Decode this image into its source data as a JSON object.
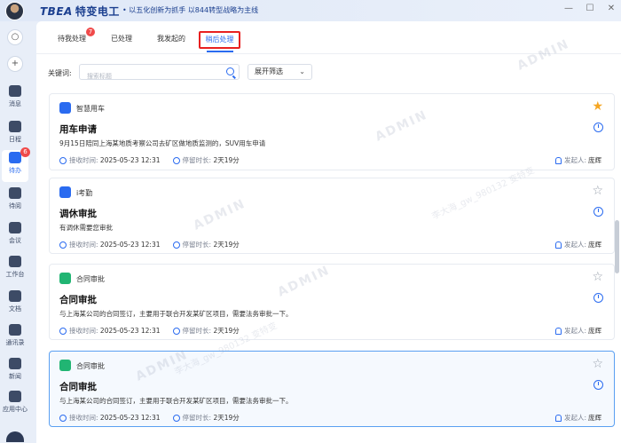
{
  "header": {
    "logo_latin": "TBEA",
    "logo_cn": "特变电工",
    "slogan": "• 以五化创新为抓手 以844转型战略为主线"
  },
  "window": {
    "minimize_icon": "minimize-icon",
    "maximize_icon": "maximize-icon",
    "close_icon": "close-icon"
  },
  "sidebar": {
    "items": [
      {
        "label": "消息",
        "icon": "message-icon"
      },
      {
        "label": "日程",
        "icon": "calendar-icon"
      },
      {
        "label": "待办",
        "icon": "todo-icon",
        "badge": "6",
        "active": true
      },
      {
        "label": "待阅",
        "icon": "toread-icon"
      },
      {
        "label": "会议",
        "icon": "meeting-icon"
      },
      {
        "label": "工作台",
        "icon": "workbench-icon"
      },
      {
        "label": "文档",
        "icon": "document-icon"
      },
      {
        "label": "通讯录",
        "icon": "contacts-icon"
      },
      {
        "label": "新闻",
        "icon": "news-icon"
      },
      {
        "label": "应用中心",
        "icon": "appcenter-icon"
      }
    ]
  },
  "tabs": [
    {
      "label": "待我处理",
      "badge": "7"
    },
    {
      "label": "已处理"
    },
    {
      "label": "我发起的"
    },
    {
      "label": "稍后处理",
      "active": true
    }
  ],
  "filters": {
    "keyword_label": "关键词:",
    "search_placeholder": "搜索标题",
    "filter_button": "展开筛选"
  },
  "cards": [
    {
      "app": "智慧用车",
      "app_color": "#2a6bf0",
      "title": "用车申请",
      "desc": "9月15日陪同上海某地质考察公司去矿区做地质监测的，SUV用车申请",
      "received_label": "接收时间:",
      "received": "2025-05-23  12:31",
      "stay_label": "停留时长:",
      "stay": "2天19分",
      "initiator_label": "发起人:",
      "initiator": "庞辉",
      "starred": true
    },
    {
      "app": "i考勤",
      "app_color": "#2a6bf0",
      "title": "调休审批",
      "desc": "有调休需要您审批",
      "received_label": "接收时间:",
      "received": "2025-05-23  12:31",
      "stay_label": "停留时长:",
      "stay": "2天19分",
      "initiator_label": "发起人:",
      "initiator": "庞辉",
      "starred": false
    },
    {
      "app": "合同审批",
      "app_color": "#21b573",
      "title": "合同审批",
      "desc": "与上海某公司的合同签订，主要用于联合开发某矿区项目，需要法务审批一下。",
      "received_label": "接收时间:",
      "received": "2025-05-23  12:31",
      "stay_label": "停留时长:",
      "stay": "2天19分",
      "initiator_label": "发起人:",
      "initiator": "庞辉",
      "starred": false
    },
    {
      "app": "合同审批",
      "app_color": "#21b573",
      "title": "合同审批",
      "desc": "与上海某公司的合同签订，主要用于联合开发某矿区项目，需要法务审批一下。",
      "received_label": "接收时间:",
      "received": "2025-05-23  12:31",
      "stay_label": "停留时长:",
      "stay": "2天19分",
      "initiator_label": "发起人:",
      "initiator": "庞辉",
      "starred": false,
      "selected": true
    }
  ],
  "watermark": {
    "main": "ADMIN",
    "sub": "李大海_gw_980132 变特变"
  }
}
